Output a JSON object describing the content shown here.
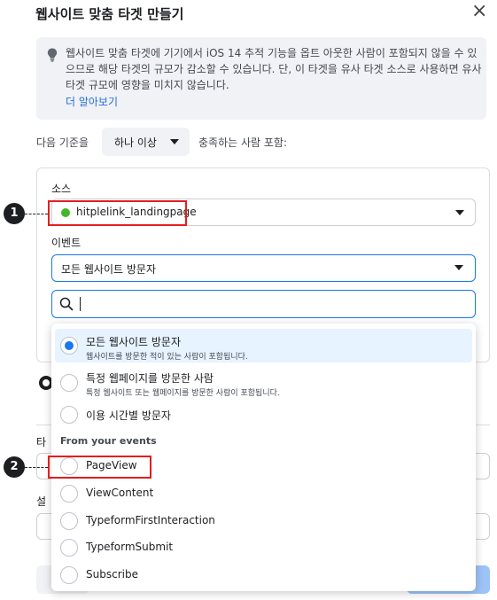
{
  "dialog": {
    "title": "웹사이트 맞춤 타겟 만들기",
    "close_symbol": "×",
    "close_icon": "close-icon"
  },
  "info": {
    "icon": "lightbulb-icon",
    "text": "웹사이트 맞춤 타겟에 기기에서 iOS 14 추적 기능을 옵트 아웃한 사람이 포함되지 않을 수 있으므로 해당 타겟의 규모가 감소할 수 있습니다. 단, 이 타겟을 유사 타겟 소스로 사용하면 유사 타겟 규모에 영향을 미치지 않습니다.",
    "link": "더 알아보기"
  },
  "criteria": {
    "prefix": "다음 기준을",
    "selected": "하나 이상",
    "suffix": "충족하는 사람 포함:"
  },
  "source": {
    "label": "소스",
    "value": "hitplelink_landingpage",
    "status_color": "#42b72a"
  },
  "event": {
    "label": "이벤트",
    "value": "모든 웹사이트 방문자"
  },
  "search": {
    "placeholder": ""
  },
  "dropdown": {
    "options": [
      {
        "title": "모든 웹사이트 방문자",
        "desc": "웹사이트를 방문한 적이 있는 사람이 포함됩니다.",
        "selected": true
      },
      {
        "title": "특정 웹페이지를 방문한 사람",
        "desc": "특정 웹사이트 또는 웹페이지를 방문한 사람이 포함됩니다.",
        "selected": false
      },
      {
        "title": "이용 시간별 방문자",
        "desc": "",
        "selected": false
      }
    ],
    "group_label": "From your events",
    "events": [
      {
        "title": "PageView"
      },
      {
        "title": "ViewContent"
      },
      {
        "title": "TypeformFirstInteraction"
      },
      {
        "title": "TypeformSubmit"
      },
      {
        "title": "Subscribe"
      }
    ]
  },
  "background": {
    "label1": "타",
    "label2": "설"
  },
  "annotations": {
    "badge1": "1",
    "badge2": "2",
    "highlight_color": "#e41e1e"
  },
  "colors": {
    "accent": "#1877f2",
    "link": "#216fdb",
    "selected_bg": "#e7f3ff"
  }
}
